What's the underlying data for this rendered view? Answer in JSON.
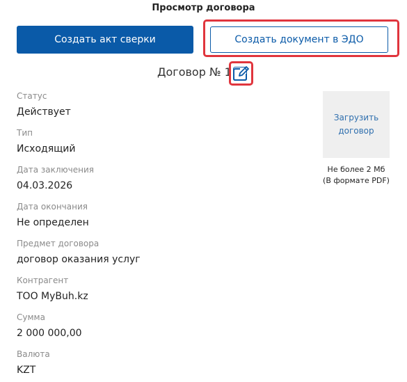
{
  "header": {
    "title": "Просмотр договора"
  },
  "actions": {
    "reconciliation_label": "Создать акт сверки",
    "edo_label": "Создать документ в ЭДО"
  },
  "contract": {
    "title": "Договор № 1"
  },
  "fields": [
    {
      "label": "Статус",
      "value": "Действует"
    },
    {
      "label": "Тип",
      "value": "Исходящий"
    },
    {
      "label": "Дата заключения",
      "value": "04.03.2026"
    },
    {
      "label": "Дата окончания",
      "value": "Не определен"
    },
    {
      "label": "Предмет договора",
      "value": "договор оказания услуг"
    },
    {
      "label": "Контрагент",
      "value": "ТОО MyBuh.kz"
    },
    {
      "label": "Сумма",
      "value": "2 000 000,00"
    },
    {
      "label": "Валюта",
      "value": "KZT"
    }
  ],
  "upload": {
    "line1": "Загрузить",
    "line2": "договор",
    "limit": "Не более 2 Мб",
    "format": "(В формате PDF)"
  },
  "icons": {
    "edit": "pencil-edit-icon"
  },
  "colors": {
    "primary": "#0a5aa8",
    "highlight": "#e0353d",
    "label": "#8a8a8a",
    "upload_bg": "#efefef"
  }
}
